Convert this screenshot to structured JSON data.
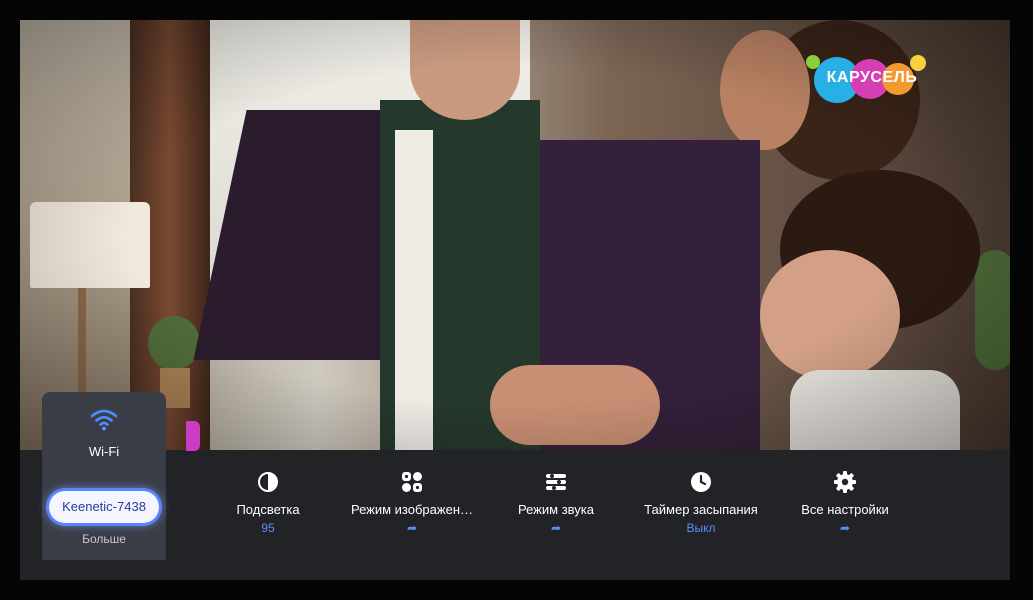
{
  "channel_logo": {
    "text": "КАРУСЕЛЬ"
  },
  "wifi": {
    "title": "Wi-Fi",
    "network": "Keenetic-7438",
    "more_label": "Больше",
    "icon": "wifi-icon"
  },
  "quick_settings": [
    {
      "label": "Подсветка",
      "value": "95",
      "icon": "brightness-icon"
    },
    {
      "label": "Режим изображен…",
      "value": "",
      "icon": "picture-mode-icon"
    },
    {
      "label": "Режим звука",
      "value": "",
      "icon": "sound-mode-icon"
    },
    {
      "label": "Таймер засыпания",
      "value": "Выкл",
      "icon": "clock-icon"
    },
    {
      "label": "Все настройки",
      "value": "",
      "icon": "gear-icon"
    }
  ],
  "colors": {
    "accent": "#5e8cff",
    "bar_bg": "#212328",
    "card_bg": "#3a3d45"
  }
}
